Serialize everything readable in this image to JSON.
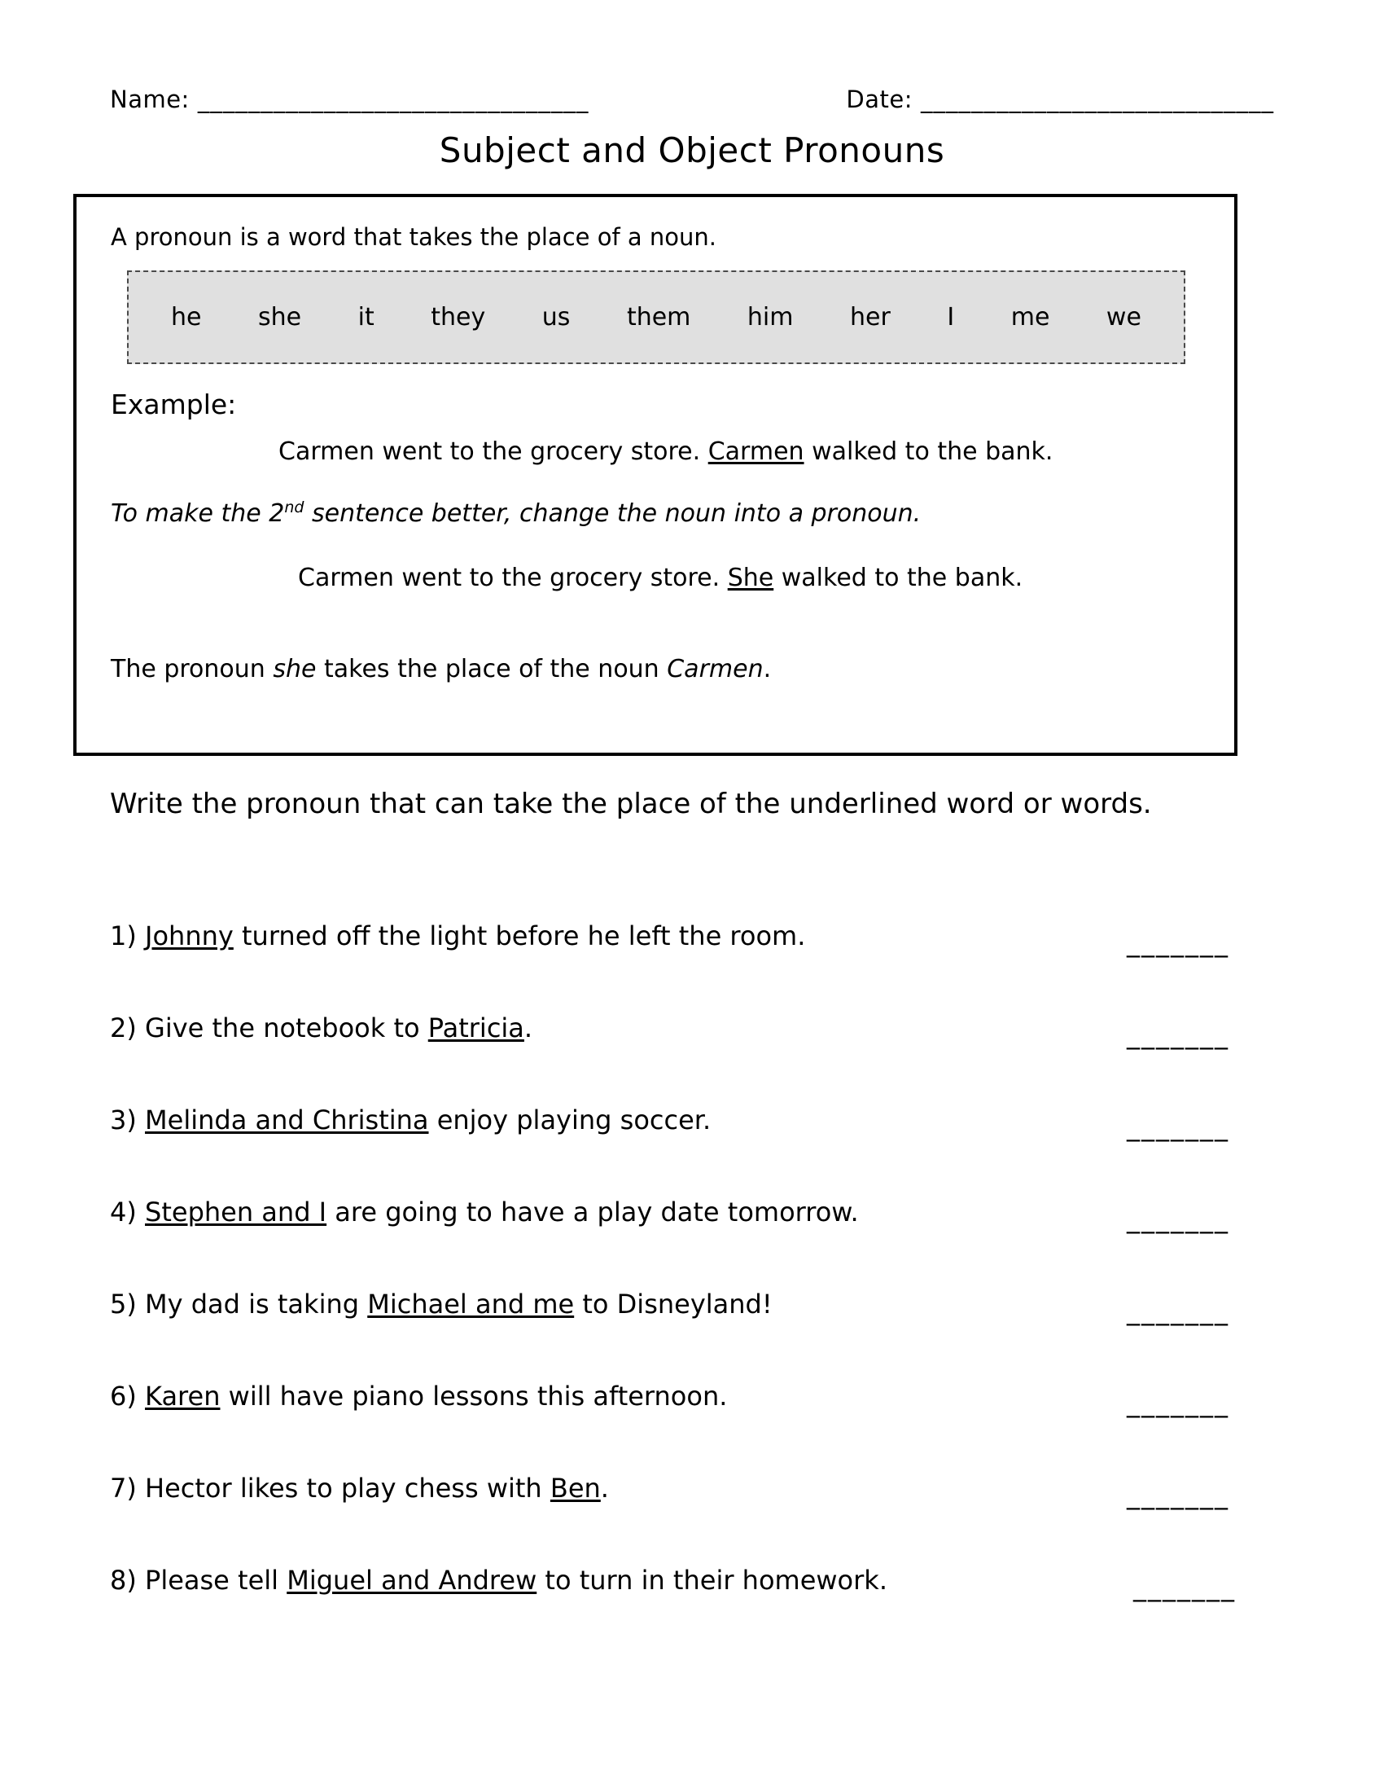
{
  "header": {
    "name_label": "Name:",
    "name_rule": "_______________________________",
    "date_label": "Date:",
    "date_rule": "____________________________"
  },
  "title": "Subject and Object Pronouns",
  "info_box": {
    "intro": "A pronoun is a word that takes the place of a noun.",
    "pronouns": [
      "he",
      "she",
      "it",
      "they",
      "us",
      "them",
      "him",
      "her",
      "I",
      "me",
      "we"
    ],
    "example_label": "Example:",
    "example_sentence_before": "Carmen went to the grocery store. ",
    "example_sentence_underlined": "Carmen",
    "example_sentence_after": " walked to the bank.",
    "note_before": "To make the 2",
    "note_sup": "nd",
    "note_after": " sentence better, change the noun into a pronoun.",
    "example_fixed_before": "Carmen went to the grocery store. ",
    "example_fixed_underlined": "She",
    "example_fixed_after": " walked to the bank.",
    "closing_1": "The pronoun ",
    "closing_italic_1": "she",
    "closing_2": " takes the place of the noun ",
    "closing_italic_2": "Carmen",
    "closing_3": "."
  },
  "directions": "Write the pronoun that can take the place of the underlined word or words.",
  "answer_blank": "_______",
  "questions": [
    {
      "number": "1)",
      "pre": " ",
      "underlined": "Johnny",
      "post": " turned off the light before he left the room."
    },
    {
      "number": "2)",
      "pre": " Give the notebook to ",
      "underlined": "Patricia",
      "post": "."
    },
    {
      "number": "3)",
      "pre": " ",
      "underlined": " Melinda and Christina",
      "post": " enjoy playing soccer."
    },
    {
      "number": "4)",
      "pre": " ",
      "underlined": "Stephen and I",
      "post": " are going to have a play date tomorrow."
    },
    {
      "number": "5)",
      "pre": " My dad is taking ",
      "underlined": "Michael and me",
      "post": " to Disneyland!"
    },
    {
      "number": "6)",
      "pre": " ",
      "underlined": "Karen",
      "post": " will have piano lessons this afternoon."
    },
    {
      "number": "7)",
      "pre": " Hector likes to play chess with ",
      "underlined": "Ben",
      "post": "."
    },
    {
      "number": "8)",
      "pre": " Please tell ",
      "underlined": "Miguel and Andrew",
      "post": " to turn in their homework."
    }
  ]
}
